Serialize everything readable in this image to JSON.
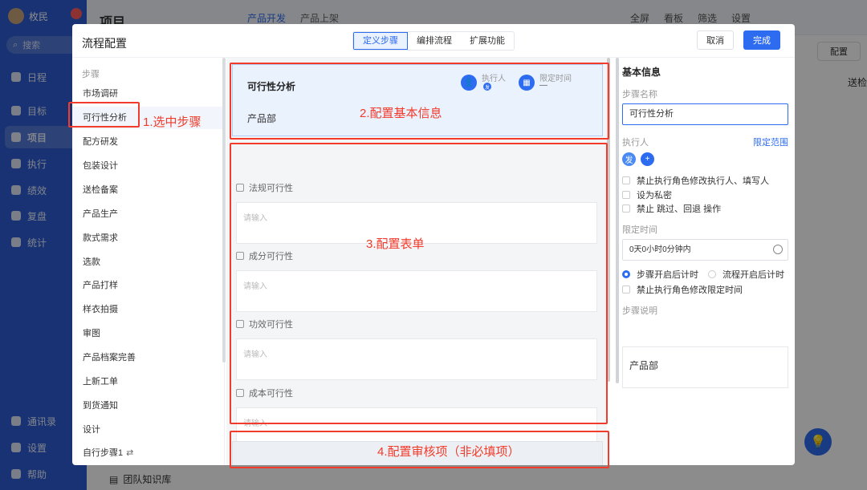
{
  "app": {
    "user": "枚民",
    "search_placeholder": "搜索",
    "nav": [
      {
        "label": "日程",
        "icon": "calendar-icon"
      },
      {
        "label": "目标",
        "icon": "target-icon"
      },
      {
        "label": "项目",
        "icon": "cube-icon"
      },
      {
        "label": "执行",
        "icon": "task-icon"
      },
      {
        "label": "绩效",
        "icon": "chart-icon"
      },
      {
        "label": "复盘",
        "icon": "review-icon"
      },
      {
        "label": "统计",
        "icon": "pie-icon"
      }
    ],
    "bottom_nav": [
      {
        "label": "通讯录",
        "icon": "contacts-icon"
      },
      {
        "label": "设置",
        "icon": "gear-icon"
      },
      {
        "label": "帮助",
        "icon": "help-icon"
      }
    ],
    "header_title": "项目",
    "header_tabs": [
      "产品开发",
      "产品上架"
    ],
    "header_tools": [
      "全屏",
      "看板",
      "筛选",
      "设置"
    ],
    "config_button": "配置",
    "partial_text": "送检",
    "knowledge": "团队知识库"
  },
  "modal": {
    "title": "流程配置",
    "tabs": [
      {
        "label": "定义步骤",
        "active": true
      },
      {
        "label": "编排流程",
        "active": false
      },
      {
        "label": "扩展功能",
        "active": false
      }
    ],
    "cancel": "取消",
    "done": "完成"
  },
  "steps": {
    "label": "步骤",
    "items": [
      "市场调研",
      "可行性分析",
      "配方研发",
      "包装设计",
      "送检备案",
      "产品生产",
      "款式需求",
      "选款",
      "产品打样",
      "样衣拍摄",
      "审图",
      "产品档案完善",
      "上新工单",
      "到货通知",
      "设计",
      "自行步骤1"
    ],
    "active_index": 1
  },
  "center": {
    "step_title": "可行性分析",
    "executor_label": "执行人",
    "executor_badge": "发",
    "time_label": "限定时间",
    "time_value": "—",
    "dept": "产品部",
    "fields": [
      {
        "label": "法规可行性",
        "placeholder": "请输入"
      },
      {
        "label": "成分可行性",
        "placeholder": "请输入"
      },
      {
        "label": "功效可行性",
        "placeholder": "请输入"
      },
      {
        "label": "成本可行性",
        "placeholder": "请输入"
      }
    ]
  },
  "right": {
    "title": "基本信息",
    "name_label": "步骤名称",
    "name_value": "可行性分析",
    "executor_label": "执行人",
    "scope_link": "限定范围",
    "executor_avatar": "发",
    "checks": [
      "禁止执行角色修改执行人、填写人",
      "设为私密",
      "禁止 跳过、回退 操作"
    ],
    "time_label": "限定时间",
    "time_value": "0天0小时0分钟内",
    "radios": [
      {
        "label": "步骤开启后计时",
        "on": true
      },
      {
        "label": "流程开启后计时",
        "on": false
      }
    ],
    "time_check": "禁止执行角色修改限定时间",
    "desc_label": "步骤说明",
    "desc_value": "产品部"
  },
  "annotations": {
    "a1": "1.选中步骤",
    "a2": "2.配置基本信息",
    "a3": "3.配置表单",
    "a4": "4.配置审核项（非必填项）"
  }
}
